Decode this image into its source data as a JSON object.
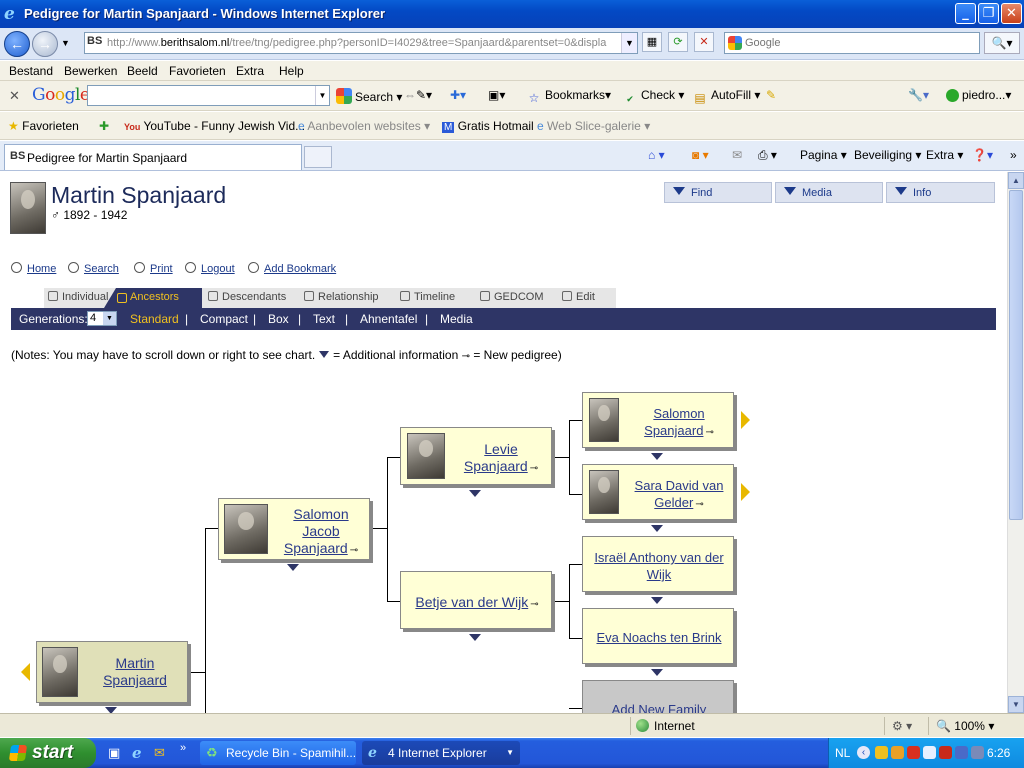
{
  "window": {
    "title": "Pedigree for Martin Spanjaard - Windows Internet Explorer"
  },
  "address": {
    "url_prefix": "http://www.",
    "url_domain": "berithsalom.nl",
    "url_path": "/tree/tng/pedigree.php?personID=I4029&tree=Spanjaard&parentset=0&displa",
    "search_placeholder": "Google"
  },
  "menubar": [
    "Bestand",
    "Bewerken",
    "Beeld",
    "Favorieten",
    "Extra",
    "Help"
  ],
  "google_toolbar": {
    "search": "Search",
    "bookmarks": "Bookmarks",
    "check": "Check",
    "autofill": "AutoFill",
    "user": "piedro..."
  },
  "favorites": {
    "label": "Favorieten",
    "items": [
      "YouTube - Funny Jewish Vid...",
      "Aanbevolen websites",
      "Gratis Hotmail",
      "Web Slice-galerie"
    ]
  },
  "tabbar": {
    "active_tab": "Pedigree for Martin Spanjaard",
    "commands": [
      "Pagina",
      "Beveiliging",
      "Extra"
    ]
  },
  "page": {
    "name": "Martin Spanjaard",
    "lifespan": "♂ 1892 - 1942",
    "top_buttons": [
      "Find",
      "Media",
      "Info"
    ],
    "links": [
      "Home",
      "Search",
      "Print",
      "Logout",
      "Add Bookmark"
    ],
    "tabs": [
      "Individual",
      "Ancestors",
      "Descendants",
      "Relationship",
      "Timeline",
      "GEDCOM",
      "Edit"
    ],
    "generations_label": "Generations:",
    "generations_value": "4",
    "views": [
      "Standard",
      "Compact",
      "Box",
      "Text",
      "Ahnentafel",
      "Media"
    ],
    "notes_a": "(Notes: You may have to scroll down or right to see chart.",
    "notes_b": "= Additional information",
    "notes_c": "= New pedigree)"
  },
  "pedigree": {
    "self": "Martin Spanjaard",
    "father": "Salomon Jacob Spanjaard",
    "paternal_grandfather": "Levie Spanjaard",
    "paternal_grandmother": "Betje van der Wijk",
    "ggf1": "Salomon Spanjaard",
    "ggm1": "Sara David van Gelder",
    "ggf2": "Israël Anthony van der Wijk",
    "ggm2": "Eva Noachs ten Brink",
    "add_family": "Add New Family"
  },
  "statusbar": {
    "zone": "Internet",
    "zoom": "100%"
  },
  "taskbar": {
    "start": "start",
    "buttons": [
      "Recycle Bin - Spamihil...",
      "4 Internet Explorer"
    ],
    "lang": "NL",
    "clock": "6:26"
  }
}
